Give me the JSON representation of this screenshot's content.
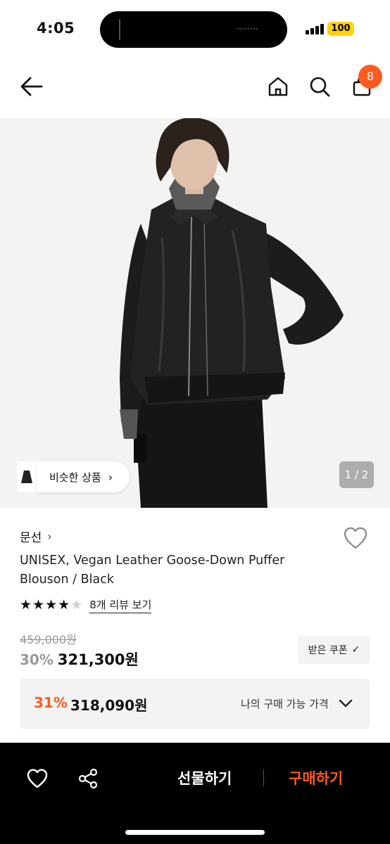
{
  "status": {
    "time": "4:05",
    "battery": "100"
  },
  "nav": {
    "cart_count": "8",
    "icons": [
      "back-arrow-icon",
      "home-icon",
      "search-icon",
      "cart-icon"
    ]
  },
  "hero": {
    "similar_label": "비슷한 상품",
    "similar_chevron": "›",
    "page_indicator": "1 / 2"
  },
  "product": {
    "brand": "문선",
    "brand_chevron": "›",
    "title": "UNISEX, Vegan Leather Goose-Down Puffer Blouson / Black",
    "rating_stars": 4,
    "review_link": "8개 리뷰 보기",
    "original_price": "459,000원",
    "sale_rate": "30%",
    "sale_price": "321,300원",
    "coupon_label": "받은 쿠폰",
    "coupon_icon": "✓"
  },
  "my_price": {
    "rate": "31%",
    "price": "318,090원",
    "label": "나의 구매 가능 가격"
  },
  "bottom_bar": {
    "gift_label": "선물하기",
    "buy_label": "구매하기"
  },
  "colors": {
    "accent": "#ff5a1f",
    "battery": "#ffd20a",
    "bottom_bar_bg": "#000000"
  }
}
